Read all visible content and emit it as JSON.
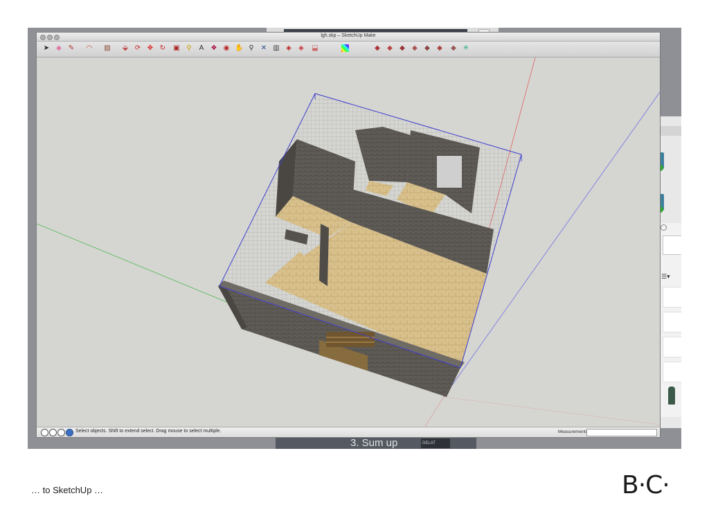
{
  "window": {
    "title": "lgh.skp – SketchUp Make"
  },
  "toolbar": {
    "icons": [
      "select-arrow-icon",
      "eraser-icon",
      "pencil-icon",
      "arc-icon",
      "rectangle-icon",
      "push-pull-icon",
      "follow-me-icon",
      "move-icon",
      "rotate-icon",
      "scale-icon",
      "tape-measure-icon",
      "text-icon",
      "paint-bucket-icon",
      "orbit-icon",
      "pan-icon",
      "zoom-icon",
      "zoom-extents-icon",
      "3d-warehouse-icon",
      "extension-icon",
      "share-icon",
      "layout-icon",
      "styles-icon",
      "iso-view-icon",
      "top-view-icon",
      "front-view-icon",
      "right-view-icon",
      "back-view-icon",
      "left-view-icon",
      "section-icon",
      "axes-icon"
    ]
  },
  "statusbar": {
    "text": "Select objects. Shift to extend select. Drag mouse to select multiple.",
    "measurements_label": "Measurements",
    "measurements_value": ""
  },
  "background": {
    "sumup_title": "3. Sum up",
    "tag": "DELAT"
  },
  "slide": {
    "caption": "… to SketchUp …",
    "logo": "B·C·"
  },
  "colors": {
    "red_axis": "#e06060",
    "green_axis": "#4fb84f",
    "blue_axis": "#6e6ee0",
    "selection": "#3d3dcf",
    "floor": "#d6bf8a",
    "wall": "#5e5a55"
  }
}
